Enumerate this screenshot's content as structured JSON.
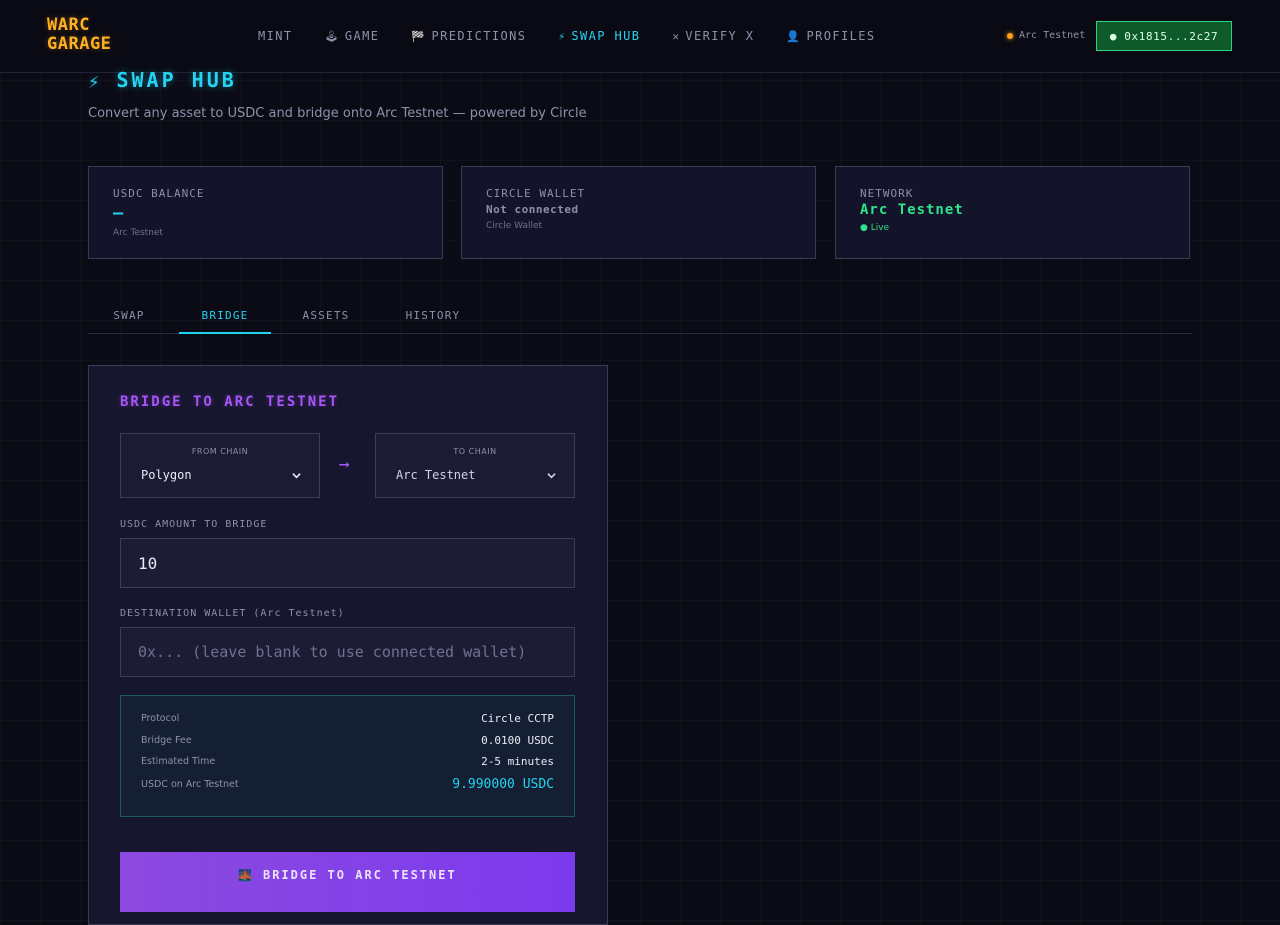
{
  "brand": {
    "line1": "WARC",
    "line2": "GARAGE"
  },
  "nav": [
    {
      "icon": "",
      "label": "MINT"
    },
    {
      "icon": "🕹",
      "label": "GAME"
    },
    {
      "icon": "🏁",
      "label": "PREDICTIONS"
    },
    {
      "icon": "⚡",
      "label": "SWAP HUB"
    },
    {
      "icon": "✕",
      "label": "VERIFY X"
    },
    {
      "icon": "👤",
      "label": "PROFILES"
    }
  ],
  "active_nav": "SWAP HUB",
  "network_indicator": "Arc Testnet",
  "wallet_button": "● 0x1815...2c27",
  "page": {
    "icon": "⚡",
    "title": "SWAP HUB",
    "subtitle": "Convert any asset to USDC and bridge onto Arc Testnet — powered by Circle"
  },
  "cards": {
    "usdc": {
      "label": "USDC BALANCE",
      "value": "—",
      "sub": "Arc Testnet"
    },
    "circle": {
      "label": "CIRCLE WALLET",
      "value": "Not connected",
      "sub": "Circle Wallet"
    },
    "network": {
      "label": "NETWORK",
      "value": "Arc Testnet",
      "sub": "● Live"
    }
  },
  "tabs": [
    "SWAP",
    "BRIDGE",
    "ASSETS",
    "HISTORY"
  ],
  "active_tab": "BRIDGE",
  "bridge": {
    "title": "BRIDGE TO ARC TESTNET",
    "from_label": "FROM CHAIN",
    "from_value": "Polygon",
    "to_label": "TO CHAIN",
    "to_value": "Arc Testnet",
    "amount_label": "USDC AMOUNT TO BRIDGE",
    "amount_value": "10",
    "dest_label": "DESTINATION WALLET (Arc Testnet)",
    "dest_placeholder": "0x... (leave blank to use connected wallet)",
    "info": [
      {
        "k": "Protocol",
        "v": "Circle CCTP"
      },
      {
        "k": "Bridge Fee",
        "v": "0.0100 USDC"
      },
      {
        "k": "Estimated Time",
        "v": "2-5 minutes"
      },
      {
        "k": "USDC on Arc Testnet",
        "v": "9.990000 USDC"
      }
    ],
    "button_icon": "🌉",
    "button_label": "BRIDGE TO ARC TESTNET"
  },
  "colors": {
    "accent_cyan": "#23d3f0",
    "accent_purple": "#a855f7",
    "brand_orange": "#ffb020",
    "live_green": "#2fe38a",
    "background": "#0b0b16"
  }
}
